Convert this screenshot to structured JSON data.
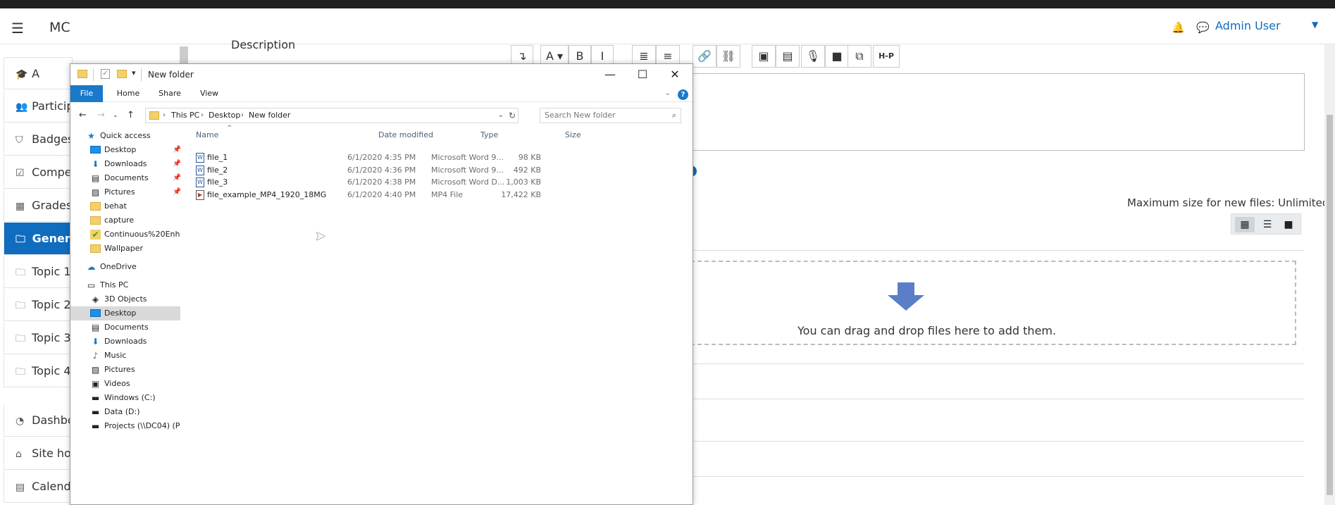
{
  "app": {
    "site_name": "MC",
    "user_name": "Admin User"
  },
  "drawer": {
    "items": [
      {
        "label": "A",
        "icon": "graduation-cap-icon",
        "glyph": "🎓"
      },
      {
        "label": "Participants",
        "icon": "users-icon",
        "glyph": "👥"
      },
      {
        "label": "Badges",
        "icon": "shield-icon",
        "glyph": "⛉"
      },
      {
        "label": "Competencies",
        "icon": "check-square-icon",
        "glyph": "☑"
      },
      {
        "label": "Grades",
        "icon": "table-icon",
        "glyph": "▦"
      },
      {
        "label": "General",
        "icon": "folder-icon",
        "glyph": "🗀"
      },
      {
        "label": "Topic 1",
        "icon": "folder-icon",
        "glyph": "🗀"
      },
      {
        "label": "Topic 2",
        "icon": "folder-icon",
        "glyph": "🗀"
      },
      {
        "label": "Topic 3",
        "icon": "folder-icon",
        "glyph": "🗀"
      },
      {
        "label": "Topic 4",
        "icon": "folder-icon",
        "glyph": "🗀"
      },
      {
        "label": "Dashboard",
        "icon": "dashboard-icon",
        "glyph": "◔"
      },
      {
        "label": "Site home",
        "icon": "home-icon",
        "glyph": "⌂"
      },
      {
        "label": "Calendar",
        "icon": "calendar-icon",
        "glyph": "▤"
      }
    ],
    "active_index": 5
  },
  "form": {
    "description_label": "Description",
    "max_size_text": "Maximum size for new files: Unlimited",
    "drop_text": "You can drag and drop files here to add them.",
    "toolbar": [
      "↴",
      "A ▾",
      "B",
      "I",
      "≣",
      "≡",
      "🔗",
      "⛓",
      "▣",
      "▤",
      "🎙",
      "■",
      "⧉",
      "H-P"
    ]
  },
  "explorer": {
    "title": "New folder",
    "ribbon_tabs": [
      "File",
      "Home",
      "Share",
      "View"
    ],
    "breadcrumb": [
      "This PC",
      "Desktop",
      "New folder"
    ],
    "search_placeholder": "Search New folder",
    "columns": {
      "name": "Name",
      "date": "Date modified",
      "type": "Type",
      "size": "Size"
    },
    "files": [
      {
        "name": "file_1",
        "date": "6/1/2020 4:35 PM",
        "type": "Microsoft Word 9...",
        "size": "98 KB",
        "kind": "doc"
      },
      {
        "name": "file_2",
        "date": "6/1/2020 4:36 PM",
        "type": "Microsoft Word 9...",
        "size": "492 KB",
        "kind": "doc"
      },
      {
        "name": "file_3",
        "date": "6/1/2020 4:38 PM",
        "type": "Microsoft Word D...",
        "size": "1,003 KB",
        "kind": "doc"
      },
      {
        "name": "file_example_MP4_1920_18MG",
        "date": "6/1/2020 4:40 PM",
        "type": "MP4 File",
        "size": "17,422 KB",
        "kind": "mp4"
      }
    ],
    "nav": {
      "quick_access": "Quick access",
      "qa_items": [
        {
          "label": "Desktop",
          "icon": "desktop-icon",
          "pinned": true
        },
        {
          "label": "Downloads",
          "icon": "download-icon",
          "pinned": true
        },
        {
          "label": "Documents",
          "icon": "documents-icon",
          "pinned": true
        },
        {
          "label": "Pictures",
          "icon": "pictures-icon",
          "pinned": true
        },
        {
          "label": "behat",
          "icon": "folder-icon",
          "pinned": false
        },
        {
          "label": "capture",
          "icon": "folder-icon",
          "pinned": false
        },
        {
          "label": "Continuous%20Enh",
          "icon": "synced-folder-icon",
          "pinned": false
        },
        {
          "label": "Wallpaper",
          "icon": "folder-icon",
          "pinned": false
        }
      ],
      "onedrive": "OneDrive",
      "this_pc": "This PC",
      "pc_items": [
        {
          "label": "3D Objects",
          "icon": "cube-icon"
        },
        {
          "label": "Desktop",
          "icon": "desktop-icon"
        },
        {
          "label": "Documents",
          "icon": "documents-icon"
        },
        {
          "label": "Downloads",
          "icon": "download-icon"
        },
        {
          "label": "Music",
          "icon": "music-icon"
        },
        {
          "label": "Pictures",
          "icon": "pictures-icon"
        },
        {
          "label": "Videos",
          "icon": "videos-icon"
        },
        {
          "label": "Windows (C:)",
          "icon": "drive-icon"
        },
        {
          "label": "Data (D:)",
          "icon": "drive-icon"
        },
        {
          "label": "Projects (\\\\DC04) (P",
          "icon": "network-drive-icon"
        }
      ],
      "selected": "Desktop"
    }
  }
}
